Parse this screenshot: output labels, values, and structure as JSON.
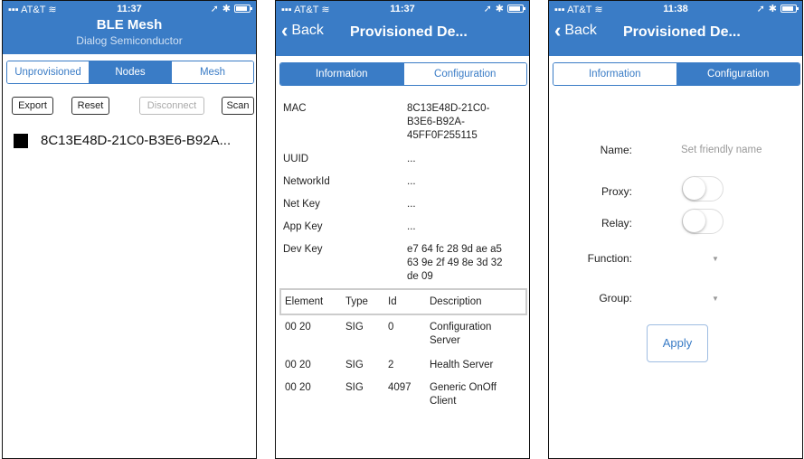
{
  "colors": {
    "accent": "#3a7cc6",
    "header_bg": "#3a7cc6"
  },
  "status_bar": [
    {
      "carrier": "AT&T",
      "time": "11:37"
    },
    {
      "carrier": "AT&T",
      "time": "11:37"
    },
    {
      "carrier": "AT&T",
      "time": "11:38"
    }
  ],
  "screen1": {
    "title": "BLE Mesh",
    "subtitle": "Dialog Semiconductor",
    "tabs": [
      "Unprovisioned",
      "Nodes",
      "Mesh"
    ],
    "selected_tab": "Nodes",
    "buttons": {
      "export": "Export",
      "reset": "Reset",
      "disconnect": "Disconnect",
      "scan": "Scan"
    },
    "node_label": "8C13E48D-21C0-B3E6-B92A..."
  },
  "screen2": {
    "back_label": "Back",
    "nav_title": "Provisioned De...",
    "tabs": [
      "Information",
      "Configuration"
    ],
    "selected_tab": "Information",
    "info": {
      "mac_key": "MAC",
      "mac_val_1": "8C13E48D-21C0-",
      "mac_val_2": "B3E6-B92A-",
      "mac_val_3": "45FF0F255115",
      "uuid_key": "UUID",
      "uuid_val": "...",
      "network_key": "NetworkId",
      "network_val": "...",
      "netkey_key": "Net Key",
      "netkey_val": "...",
      "appkey_key": "App Key",
      "appkey_val": "...",
      "devkey_key": "Dev Key",
      "devkey_val_1": "e7 64 fc 28 9d ae a5",
      "devkey_val_2": "63 9e 2f 49 8e 3d 32",
      "devkey_val_3": "de 09"
    },
    "table": {
      "headers": {
        "element": "Element",
        "type": "Type",
        "id": "Id",
        "description": "Description"
      },
      "rows": [
        {
          "element": "00 20",
          "type": "SIG",
          "id": "0",
          "desc_1": "Configuration",
          "desc_2": "Server"
        },
        {
          "element": "00 20",
          "type": "SIG",
          "id": "2",
          "desc_1": "Health Server",
          "desc_2": ""
        },
        {
          "element": "00 20",
          "type": "SIG",
          "id": "4097",
          "desc_1": "Generic OnOff",
          "desc_2": "Client"
        }
      ]
    }
  },
  "screen3": {
    "back_label": "Back",
    "nav_title": "Provisioned De...",
    "tabs": [
      "Information",
      "Configuration"
    ],
    "selected_tab": "Configuration",
    "form": {
      "name_label": "Name:",
      "name_placeholder": "Set friendly name",
      "proxy_label": "Proxy:",
      "proxy_on": false,
      "relay_label": "Relay:",
      "relay_on": false,
      "function_label": "Function:",
      "group_label": "Group:",
      "apply_label": "Apply"
    }
  }
}
